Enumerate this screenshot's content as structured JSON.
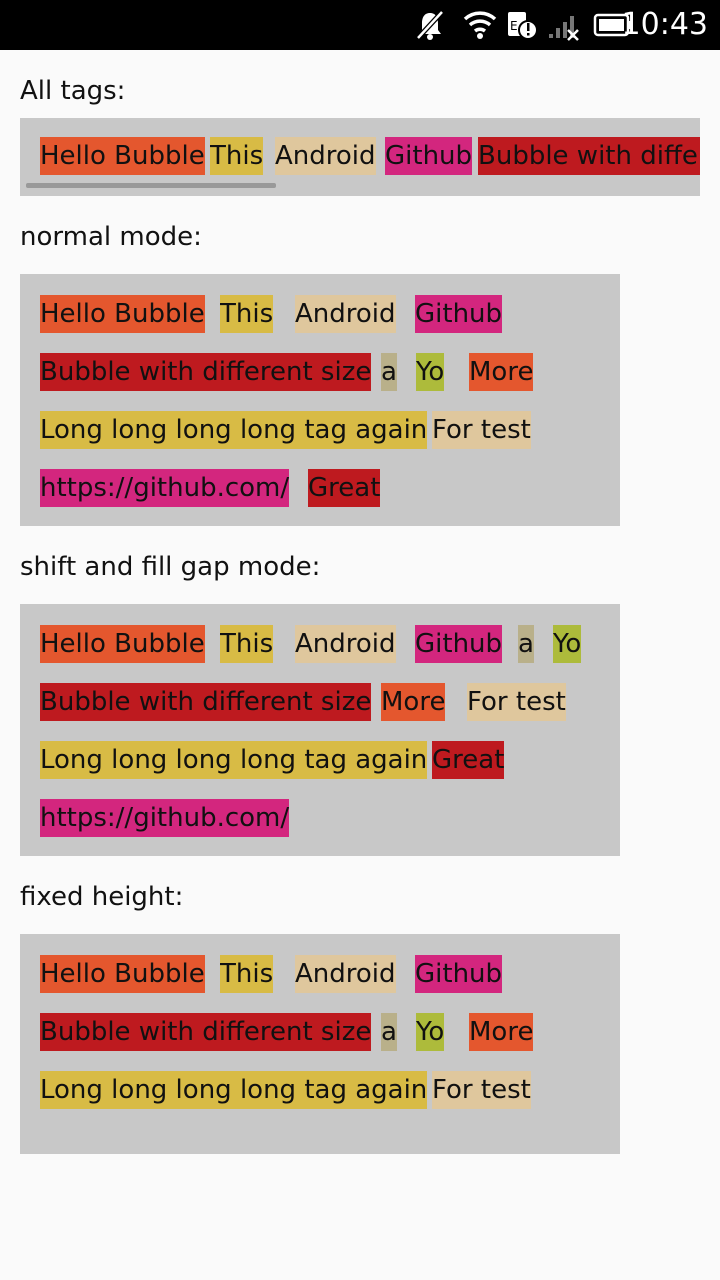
{
  "status_bar": {
    "time": "10:43",
    "icons": [
      "notifications-muted-icon",
      "wifi-icon",
      "sim-alert-icon",
      "signal-icon",
      "battery-icon"
    ]
  },
  "colors": {
    "orange": "#e4572e",
    "yellow": "#d8bb45",
    "beige": "#dfc79d",
    "magenta": "#d3267e",
    "red": "#be1a1f",
    "khaki": "#b9b08a",
    "lime": "#adbb3b",
    "panel": "#c8c8c8"
  },
  "sections": {
    "all_tags": {
      "label": "All tags:",
      "tags": [
        "Hello Bubble",
        "This",
        "Android",
        "Github",
        "Bubble with differ"
      ]
    },
    "normal": {
      "label": "normal mode:",
      "tags": [
        "Hello Bubble",
        "This",
        "Android",
        "Github",
        "Bubble with different size",
        "a",
        "Yo",
        "More",
        "Long long long long tag again",
        "For test",
        "https://github.com/",
        "Great"
      ]
    },
    "shift": {
      "label": "shift and fill gap mode:",
      "tags": [
        "Hello Bubble",
        "This",
        "Android",
        "Github",
        "a",
        "Yo",
        "Bubble with different size",
        "More",
        "For test",
        "Long long long long tag again",
        "Great",
        "https://github.com/"
      ]
    },
    "fixed": {
      "label": "fixed height:",
      "tags": [
        "Hello Bubble",
        "This",
        "Android",
        "Github",
        "Bubble with different size",
        "a",
        "Yo",
        "More",
        "Long long long long tag again",
        "For test"
      ]
    }
  }
}
